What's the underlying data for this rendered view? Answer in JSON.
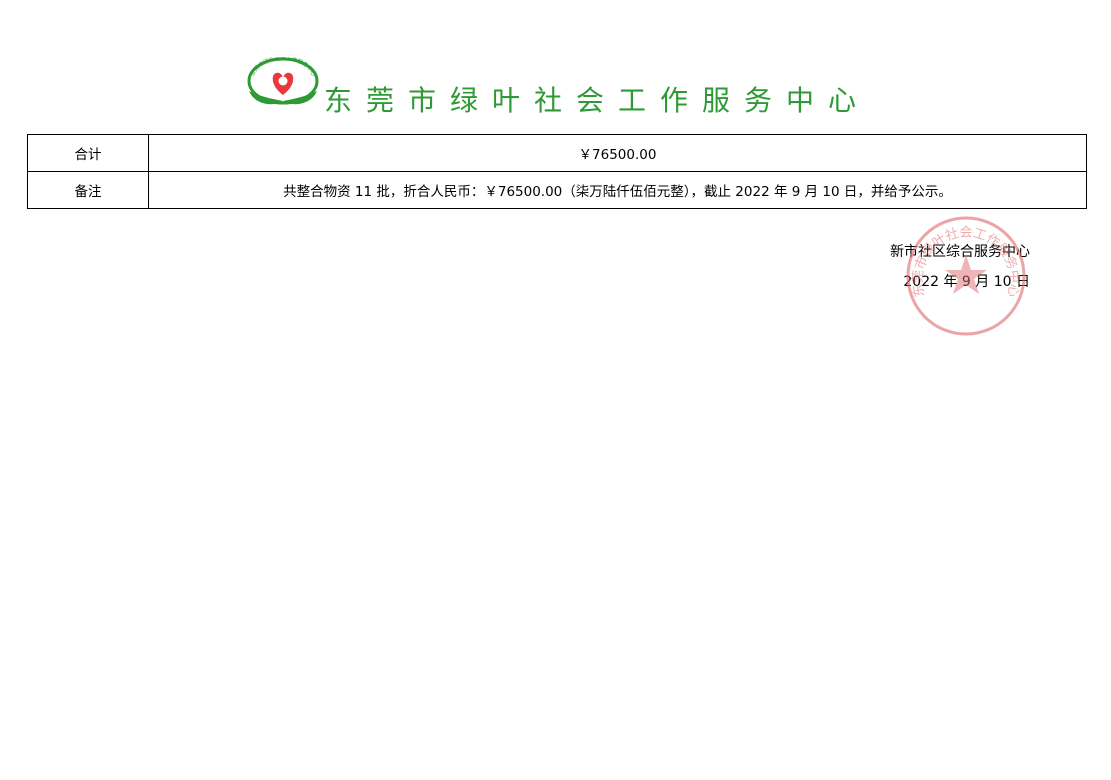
{
  "header": {
    "logo_icon": "green-leaf-heart-logo-icon",
    "logo_ring_text": "东莞市绿叶社会工作服务中心",
    "org_name": "东莞市绿叶社会工作服务中心"
  },
  "summary": {
    "total_label": "合计",
    "total_value": "￥76500.00",
    "remark_label": "备注",
    "remark_value": "共整合物资 11 批，折合人民币：￥76500.00（柒万陆仟伍佰元整），截止 2022 年 9 月 10 日，并给予公示。"
  },
  "signature": {
    "issuer": "新市社区综合服务中心",
    "date": "2022 年 9 月 10 日"
  },
  "stamp": {
    "icon": "red-official-seal-icon",
    "text": "东莞市绿叶社会工作服务中心",
    "color": "#e0696c"
  },
  "colors": {
    "title_green": "#2e9a35",
    "logo_red": "#e8383d",
    "logo_green": "#2e9a35"
  }
}
